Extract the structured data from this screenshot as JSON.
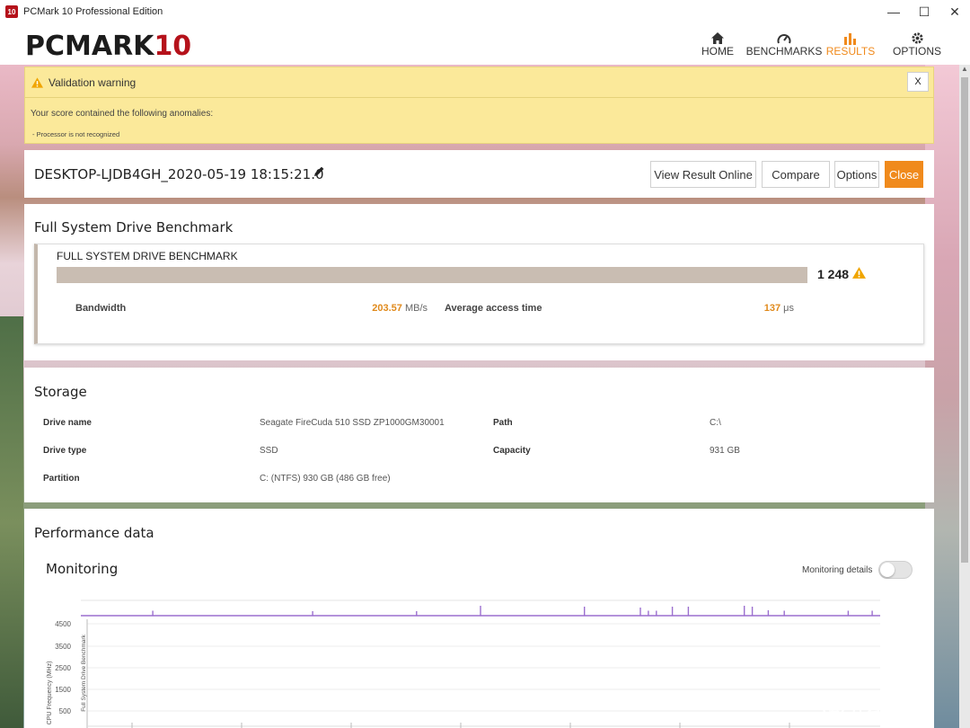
{
  "window": {
    "title": "PCMark 10 Professional Edition",
    "icon_text": "10",
    "min": "—",
    "max": "☐",
    "close": "✕"
  },
  "header": {
    "logo_main": "PCMARK",
    "logo_num": "10",
    "nav": [
      {
        "label": "HOME",
        "icon": "home-icon"
      },
      {
        "label": "BENCHMARKS",
        "icon": "gauge-icon"
      },
      {
        "label": "RESULTS",
        "icon": "bar-chart-icon",
        "active": true
      },
      {
        "label": "OPTIONS",
        "icon": "gear-icon"
      }
    ]
  },
  "warning": {
    "title": "Validation warning",
    "close": "X",
    "text": "Your score contained the following anomalies:",
    "item": "- Processor is not recognized"
  },
  "result": {
    "title": "DESKTOP-LJDB4GH_2020-05-19 18:15:21.0",
    "buttons": {
      "view_online": "View Result Online",
      "compare": "Compare",
      "options": "Options",
      "close": "Close"
    }
  },
  "benchmark": {
    "section_title": "Full System Drive Benchmark",
    "card_title": "FULL SYSTEM DRIVE BENCHMARK",
    "score": "1 248",
    "bandwidth_label": "Bandwidth",
    "bandwidth_value": "203.57",
    "bandwidth_unit": "MB/s",
    "access_label": "Average access time",
    "access_value": "137",
    "access_unit": "μs"
  },
  "storage": {
    "title": "Storage",
    "drive_name_label": "Drive name",
    "drive_name": "Seagate FireCuda 510 SSD ZP1000GM30001",
    "drive_type_label": "Drive type",
    "drive_type": "SSD",
    "partition_label": "Partition",
    "partition": "C: (NTFS) 930 GB (486 GB free)",
    "path_label": "Path",
    "path": "C:\\",
    "capacity_label": "Capacity",
    "capacity": "931 GB"
  },
  "performance": {
    "title": "Performance data",
    "monitoring_title": "Monitoring",
    "monitoring_details": "Monitoring details"
  },
  "chart_data": {
    "type": "line",
    "ylabel": "CPU Frequency (MHz)",
    "series_label": "Full System Drive Benchmark",
    "y_ticks": [
      "4500",
      "3500",
      "2500",
      "1500",
      "500"
    ],
    "spike_positions": [
      0.09,
      0.29,
      0.42,
      0.5,
      0.63,
      0.7,
      0.71,
      0.72,
      0.74,
      0.76,
      0.83,
      0.84,
      0.86,
      0.88,
      0.96,
      0.99
    ],
    "spike_heights": [
      0.15,
      0.1,
      0.1,
      0.7,
      0.6,
      0.5,
      0.15,
      0.15,
      0.6,
      0.6,
      0.7,
      0.6,
      0.2,
      0.15,
      0.15,
      0.15
    ],
    "series_color": "#9b6fcf"
  },
  "watermark": {
    "text": "什么值得买",
    "icon": "值"
  }
}
